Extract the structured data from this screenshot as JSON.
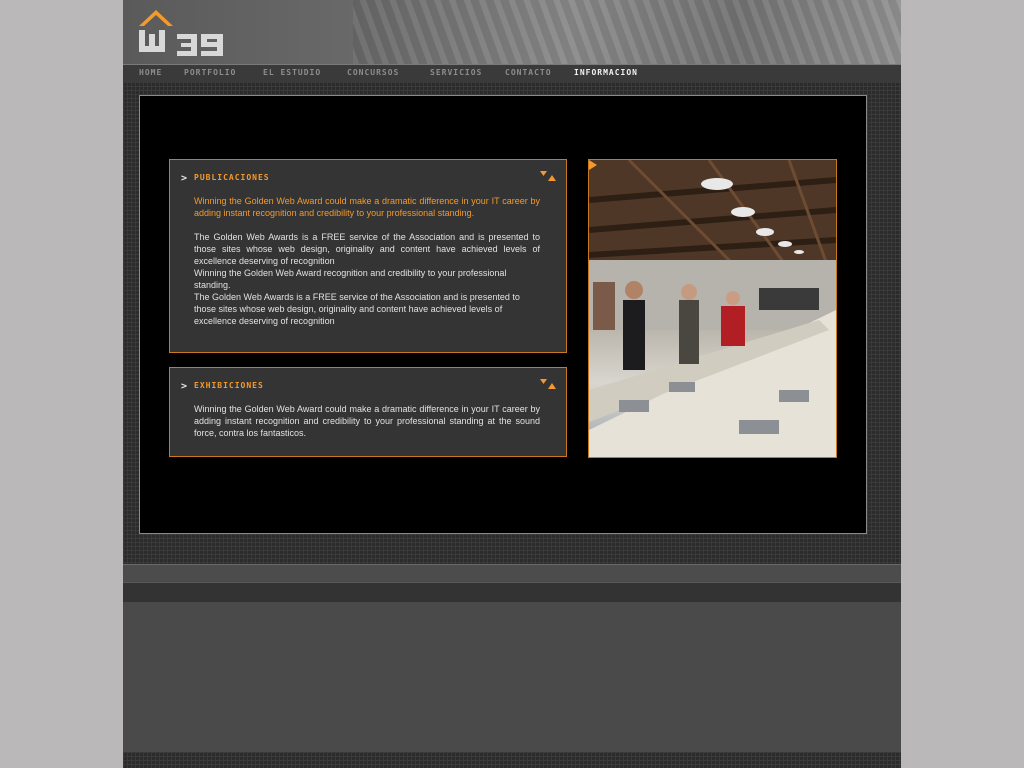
{
  "brand": {
    "logo_text": "W39",
    "accent": "#f59a2a",
    "border_accent": "#c8781e"
  },
  "nav": {
    "items": [
      {
        "label": "HOME"
      },
      {
        "label": "PORTFOLIO"
      },
      {
        "label": "EL ESTUDIO"
      },
      {
        "label": "CONCURSOS"
      },
      {
        "label": "SERVICIOS"
      },
      {
        "label": "CONTACTO"
      },
      {
        "label": "INFORMACION",
        "active": true
      }
    ]
  },
  "publicaciones": {
    "arrow": ">",
    "title": "PUBLICACIONES",
    "highlight": "Winning the Golden Web Award could make a dramatic difference in your IT career by adding instant recognition and credibility to your professional standing.",
    "body_1": "The Golden Web Awards is a FREE service of the Association and is presented to those sites whose web design, originality and content have achieved levels of excellence deserving of recognition",
    "body_2": "Winning the Golden Web Award recognition and credibility to your professional standing.",
    "body_3": "The Golden Web Awards is a FREE service of the Association and is presented to those sites whose web design, originality and content have achieved levels of excellence deserving of recognition"
  },
  "exhibiciones": {
    "arrow": ">",
    "title": "EXHIBICIONES",
    "body": "Winning the Golden Web Award could make a dramatic difference in your IT career by adding instant recognition and credibility to your professional standing at the sound force, contra los fantasticos."
  },
  "photo": {
    "icon": "play-next-icon"
  }
}
